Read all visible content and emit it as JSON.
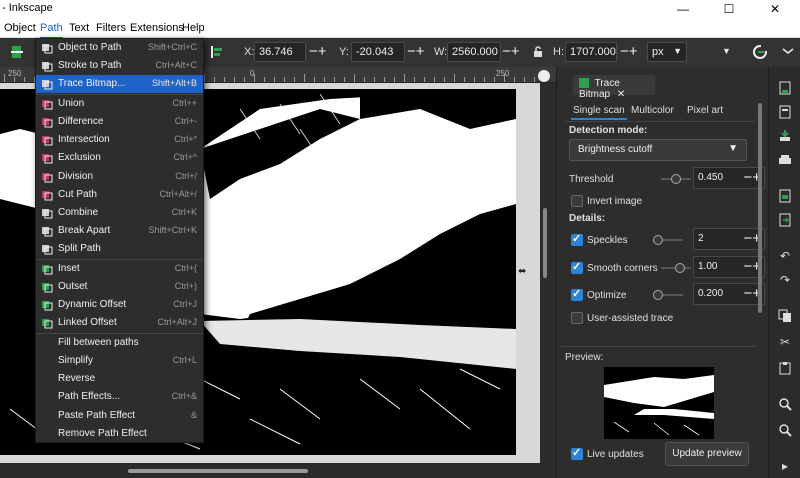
{
  "window": {
    "title": "- Inkscape",
    "minimize": "—",
    "maximize": "☐",
    "close": "✕"
  },
  "menubar": [
    "Object",
    "Path",
    "Text",
    "Filters",
    "Extensions",
    "Help"
  ],
  "toolbar": {
    "x_label": "X:",
    "x_value": "36.746",
    "y_label": "Y:",
    "y_value": "-20.043",
    "w_label": "W:",
    "w_value": "2560.000",
    "h_label": "H:",
    "h_value": "1707.000",
    "unit": "px",
    "plus_minus": "−+"
  },
  "ruler": [
    "250",
    "0",
    "250"
  ],
  "path_menu": [
    {
      "label": "Object to Path",
      "shortcut": "Shift+Ctrl+C",
      "icon": "object-to-path-icon"
    },
    {
      "label": "Stroke to Path",
      "shortcut": "Ctrl+Alt+C",
      "icon": "stroke-to-path-icon"
    },
    {
      "label": "Trace Bitmap...",
      "shortcut": "Shift+Alt+B",
      "icon": "trace-bitmap-icon",
      "highlighted": true
    },
    {
      "label": "Union",
      "shortcut": "Ctrl++",
      "icon": "union-icon"
    },
    {
      "label": "Difference",
      "shortcut": "Ctrl+-",
      "icon": "difference-icon"
    },
    {
      "label": "Intersection",
      "shortcut": "Ctrl+*",
      "icon": "intersection-icon"
    },
    {
      "label": "Exclusion",
      "shortcut": "Ctrl+^",
      "icon": "exclusion-icon"
    },
    {
      "label": "Division",
      "shortcut": "Ctrl+/",
      "icon": "division-icon"
    },
    {
      "label": "Cut Path",
      "shortcut": "Ctrl+Alt+/",
      "icon": "cut-path-icon"
    },
    {
      "label": "Combine",
      "shortcut": "Ctrl+K",
      "icon": "combine-icon"
    },
    {
      "label": "Break Apart",
      "shortcut": "Shift+Ctrl+K",
      "icon": "break-apart-icon"
    },
    {
      "label": "Split Path",
      "shortcut": "",
      "icon": "split-path-icon"
    },
    {
      "label": "Inset",
      "shortcut": "Ctrl+(",
      "icon": "inset-icon"
    },
    {
      "label": "Outset",
      "shortcut": "Ctrl+)",
      "icon": "outset-icon"
    },
    {
      "label": "Dynamic Offset",
      "shortcut": "Ctrl+J",
      "icon": "dynamic-offset-icon"
    },
    {
      "label": "Linked Offset",
      "shortcut": "Ctrl+Alt+J",
      "icon": "linked-offset-icon"
    },
    {
      "label": "Fill between paths",
      "shortcut": "",
      "icon": ""
    },
    {
      "label": "Simplify",
      "shortcut": "Ctrl+L",
      "icon": ""
    },
    {
      "label": "Reverse",
      "shortcut": "",
      "icon": ""
    },
    {
      "label": "Path Effects...",
      "shortcut": "Ctrl+&",
      "icon": ""
    },
    {
      "label": "Paste Path Effect",
      "shortcut": "&",
      "icon": ""
    },
    {
      "label": "Remove Path Effect",
      "shortcut": "",
      "icon": ""
    }
  ],
  "panel": {
    "tab_title": "Trace Bitmap",
    "close": "✕",
    "tabs": [
      "Single scan",
      "Multicolor",
      "Pixel art"
    ],
    "detection_mode_label": "Detection mode:",
    "detection_mode_value": "Brightness cutoff",
    "threshold_label": "Threshold",
    "threshold_value": "0.450",
    "invert_label": "Invert image",
    "details_label": "Details:",
    "speckles_label": "Speckles",
    "speckles_value": "2",
    "smooth_label": "Smooth corners",
    "smooth_value": "1.00",
    "optimize_label": "Optimize",
    "optimize_value": "0.200",
    "user_assisted_label": "User-assisted trace",
    "preview_label": "Preview:",
    "live_updates_label": "Live updates",
    "update_preview_label": "Update preview",
    "chevron": "▼"
  },
  "colors": {
    "accent": "#1e64c8",
    "checkbox": "#2a84d8",
    "panel_bg": "#2d2d2d"
  }
}
